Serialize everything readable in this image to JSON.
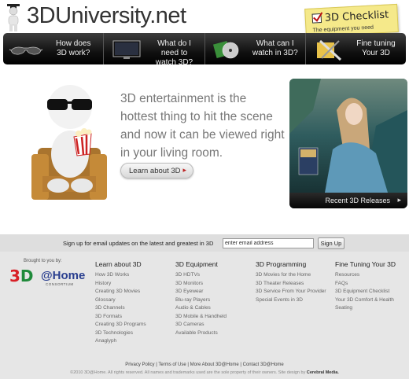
{
  "header": {
    "site_name": "3DUniversity.net",
    "checklist_title": "3D Checklist",
    "checklist_subtitle": "The equipment you need"
  },
  "nav": {
    "items": [
      {
        "label": "How does 3D work?",
        "icon": "3d-glasses-icon"
      },
      {
        "label": "What do I need to watch 3D?",
        "icon": "tv-icon"
      },
      {
        "label": "What can I watch in 3D?",
        "icon": "bluray-disc-icon"
      },
      {
        "label": "Fine tuning Your 3D",
        "icon": "tools-icon"
      }
    ]
  },
  "hero": {
    "text": "3D entertainment is the hottest thing to hit the scene and now it can be viewed right in your living room.",
    "learn_button": "Learn about 3D",
    "release_label": "Recent 3D Releases"
  },
  "signup": {
    "label": "Sign up for email updates on the latest and greatest in 3D",
    "input_value": "enter email address",
    "button": "Sign Up"
  },
  "brought_by": "Brought to you by:",
  "partner": {
    "logo_left": "3D",
    "logo_right": "@Home",
    "logo_sub": "CONSORTIUM"
  },
  "columns": [
    {
      "heading": "Learn about 3D",
      "links": [
        "How 3D Works",
        "History",
        "Creating 3D Movies",
        "Glossary",
        "3D Channels",
        "3D Formats",
        "Creating 3D Programs",
        "3D Technologies",
        "Anaglyph"
      ]
    },
    {
      "heading": "3D Equipment",
      "links": [
        "3D HDTVs",
        "3D Monitors",
        "3D Eyewear",
        "Blu-ray Players",
        "Audio & Cables",
        "3D Mobile & Handheld",
        "3D Cameras",
        "Available Products"
      ]
    },
    {
      "heading": "3D Programming",
      "links": [
        "3D Movies for the Home",
        "3D Theater Releases",
        "3D Service From Your Provider",
        "Special Events in 3D"
      ]
    },
    {
      "heading": "Fine Tuning Your 3D",
      "links": [
        "Resources",
        "FAQs",
        "3D Equipment Checklist",
        "Your 3D Comfort & Health",
        "Seating"
      ]
    }
  ],
  "footer": {
    "legal_links": [
      "Privacy Policy",
      "Terms of Use",
      "More About 3D@Home",
      "Contact 3D@Home"
    ],
    "copyright": "©2010 3D@Home. All rights reserved. All names and trademarks used are the sole property of their owners. Site design by",
    "designer": "Cerebral Media."
  },
  "colors": {
    "nav_bg": "#111111",
    "footer_bg": "#e6e6e6",
    "hero_text": "#777777",
    "accent_red": "#bb2222"
  }
}
